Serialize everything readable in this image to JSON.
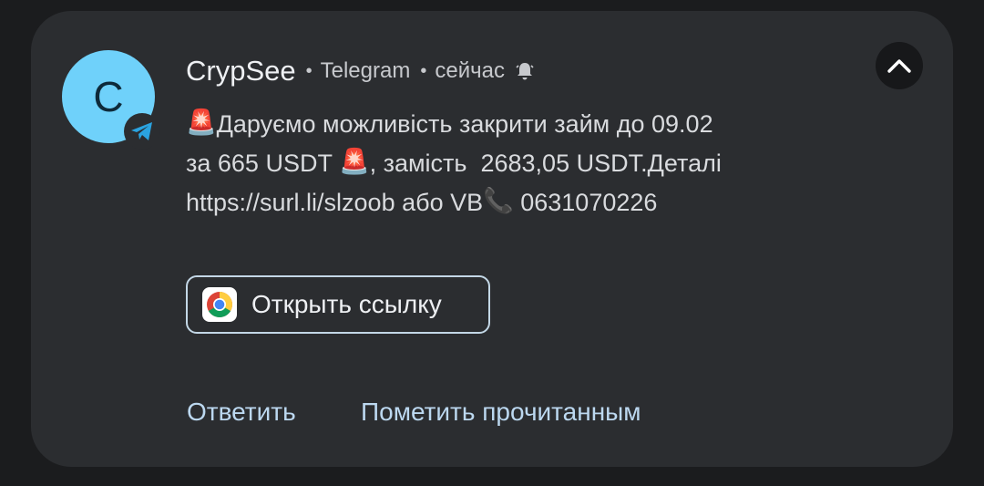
{
  "notification": {
    "avatar_letter": "C",
    "app_icon": "telegram-icon",
    "sender": "CrypSee",
    "app_name": "Telegram",
    "time": "сейчас",
    "bell_icon": "bell-icon",
    "expand_icon": "chevron-up-icon",
    "message": {
      "line1_pre": "🚨",
      "line1_text": "Даруємо можливість закрити займ до 09.02",
      "line2_text": "за 665 USDT ",
      "line2_emoji": "🚨",
      "line2_tail": ", замість  2683,05 USDT.Деталі",
      "line3_text": "https://surl.li/slzoob або VB",
      "line3_emoji": "📞",
      "line3_tail": " 0631070226"
    },
    "open_link": {
      "icon": "chrome-icon",
      "label": "Открыть ссылку"
    },
    "actions": {
      "reply": "Ответить",
      "mark_read": "Пометить прочитанным"
    },
    "colors": {
      "card_bg": "#2b2d30",
      "avatar_bg": "#6fd1fa",
      "telegram_blue": "#2aa3e0",
      "action_text": "#bcd8f0"
    }
  }
}
